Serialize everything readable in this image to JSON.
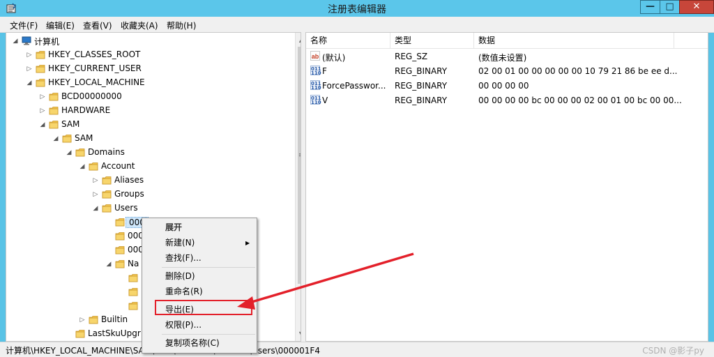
{
  "window": {
    "title": "注册表编辑器",
    "minimize_glyph": "—",
    "maximize_glyph": "□",
    "close_glyph": "✕"
  },
  "menu": [
    "文件(F)",
    "编辑(E)",
    "查看(V)",
    "收藏夹(A)",
    "帮助(H)"
  ],
  "tree": {
    "nodes": [
      {
        "label": "计算机",
        "expander": "expanded",
        "icon": "computer-icon"
      },
      {
        "label": "HKEY_CLASSES_ROOT",
        "expander": "collapsed",
        "icon": "folder-icon"
      },
      {
        "label": "HKEY_CURRENT_USER",
        "expander": "collapsed",
        "icon": "folder-icon"
      },
      {
        "label": "HKEY_LOCAL_MACHINE",
        "expander": "expanded",
        "icon": "folder-icon"
      },
      {
        "label": "BCD00000000",
        "expander": "collapsed",
        "icon": "folder-icon"
      },
      {
        "label": "HARDWARE",
        "expander": "collapsed",
        "icon": "folder-icon"
      },
      {
        "label": "SAM",
        "expander": "expanded",
        "icon": "folder-icon"
      },
      {
        "label": "SAM",
        "expander": "expanded",
        "icon": "folder-icon"
      },
      {
        "label": "Domains",
        "expander": "expanded",
        "icon": "folder-icon"
      },
      {
        "label": "Account",
        "expander": "expanded",
        "icon": "folder-icon"
      },
      {
        "label": "Aliases",
        "expander": "collapsed",
        "icon": "folder-icon"
      },
      {
        "label": "Groups",
        "expander": "collapsed",
        "icon": "folder-icon"
      },
      {
        "label": "Users",
        "expander": "expanded",
        "icon": "folder-icon"
      },
      {
        "label": "000",
        "expander": "none",
        "icon": "folder-icon",
        "selected": true
      },
      {
        "label": "000",
        "expander": "none",
        "icon": "folder-icon"
      },
      {
        "label": "000",
        "expander": "none",
        "icon": "folder-icon"
      },
      {
        "label": "Na",
        "expander": "expanded",
        "icon": "folder-icon"
      },
      {
        "label": "",
        "expander": "none",
        "icon": "folder-icon"
      },
      {
        "label": "",
        "expander": "none",
        "icon": "folder-icon"
      },
      {
        "label": "",
        "expander": "none",
        "icon": "folder-icon"
      },
      {
        "label": "Builtin",
        "expander": "collapsed",
        "icon": "folder-icon"
      },
      {
        "label": "LastSkuUpgr",
        "expander": "none",
        "icon": "folder-icon"
      }
    ]
  },
  "list": {
    "columns": [
      "名称",
      "类型",
      "数据"
    ],
    "rows": [
      {
        "name": "(默认)",
        "type": "REG_SZ",
        "data": "(数值未设置)",
        "icon": "string-value-icon"
      },
      {
        "name": "F",
        "type": "REG_BINARY",
        "data": "02 00 01 00 00 00 00 00 10 79 21 86 be ee d...",
        "icon": "binary-value-icon"
      },
      {
        "name": "ForcePasswor...",
        "type": "REG_BINARY",
        "data": "00 00 00 00",
        "icon": "binary-value-icon"
      },
      {
        "name": "V",
        "type": "REG_BINARY",
        "data": "00 00 00 00 bc 00 00 00 02 00 01 00 bc 00 00...",
        "icon": "binary-value-icon"
      }
    ]
  },
  "context_menu": {
    "items": [
      {
        "label": "展开",
        "style": "bold"
      },
      {
        "label": "新建(N)",
        "submenu": true
      },
      {
        "label": "查找(F)..."
      },
      {
        "separator": true
      },
      {
        "label": "删除(D)"
      },
      {
        "label": "重命名(R)"
      },
      {
        "separator": true
      },
      {
        "label": "导出(E)",
        "highlighted": true
      },
      {
        "label": "权限(P)..."
      },
      {
        "separator": true
      },
      {
        "label": "复制项名称(C)"
      }
    ]
  },
  "status": {
    "path": "计算机\\HKEY_LOCAL_MACHINE\\SAM\\SAM\\Domains\\Account\\Users\\000001F4",
    "watermark": "CSDN @影子py"
  },
  "colors": {
    "titlebar": "#5bc6ea",
    "annotation": "#e3202a"
  }
}
